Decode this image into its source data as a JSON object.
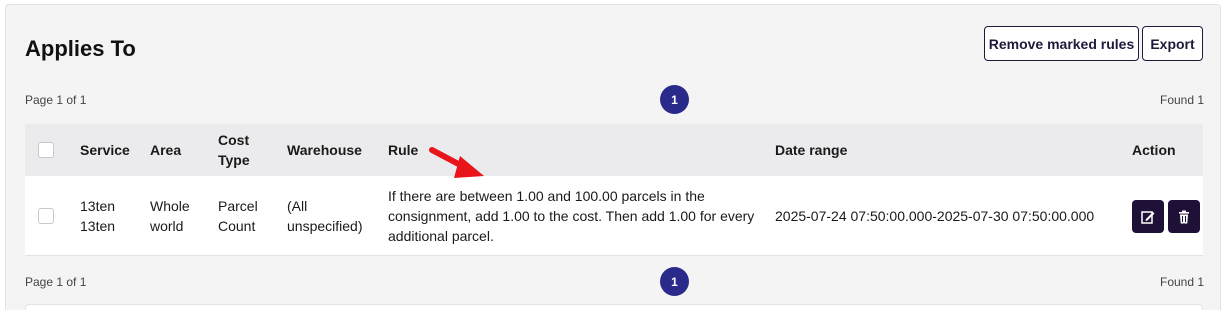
{
  "section": {
    "title": "Applies To"
  },
  "toolbar": {
    "remove_label": "Remove marked rules",
    "export_label": "Export"
  },
  "pager_top": {
    "page_text": "Page 1 of 1",
    "current_page": "1",
    "found_text": "Found 1"
  },
  "pager_bottom": {
    "page_text": "Page 1 of 1",
    "current_page": "1",
    "found_text": "Found 1"
  },
  "table": {
    "columns": {
      "service": "Service",
      "area": "Area",
      "cost_type_1": "Cost",
      "cost_type_2": "Type",
      "warehouse": "Warehouse",
      "rule": "Rule",
      "date_range": "Date range",
      "action": "Action"
    },
    "rows": [
      {
        "service_1": "13ten",
        "service_2": "13ten",
        "area_1": "Whole",
        "area_2": "world",
        "cost_type_1": "Parcel",
        "cost_type_2": "Count",
        "warehouse_1": "(All",
        "warehouse_2": "unspecified)",
        "rule_1": "If there are between 1.00 and 100.00 parcels in the",
        "rule_2": "consignment, add 1.00 to the cost. Then add 1.00 for every",
        "rule_3": "additional parcel.",
        "date_range": "2025-07-24 07:50:00.000-2025-07-30 07:50:00.000",
        "edit_icon": "edit-icon",
        "delete_icon": "trash-icon"
      }
    ]
  },
  "colors": {
    "accent_dark": "#1e1036",
    "page_bubble": "#2a2a8a",
    "annotation_arrow": "#e8161b"
  }
}
